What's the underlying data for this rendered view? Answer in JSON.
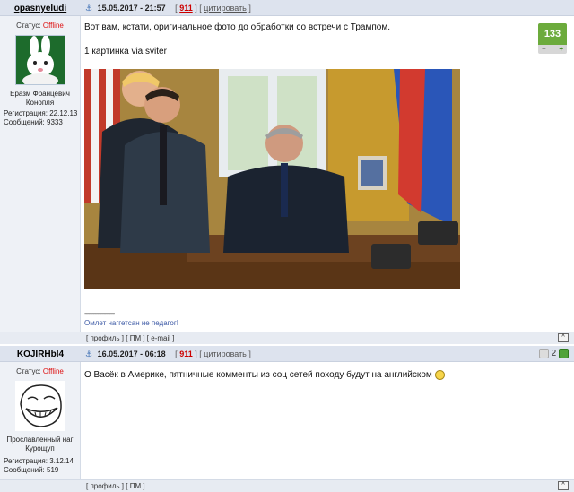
{
  "posts": [
    {
      "username": "opasnyeludi",
      "status_label": "Статус:",
      "status_value": "Offline",
      "rank": [
        "Еразм Францевич",
        "Конопля"
      ],
      "registration": "Регистрация: 22.12.13",
      "messages": "Сообщений: 9333",
      "date": "15.05.2017 - 21:57",
      "post_number": "911",
      "cite_label": "цитировать",
      "text_lines": [
        "Вот вам, кстати, оригинальное фото до обработки со встречи с Трампом.",
        "1 картинка via sviter"
      ],
      "signature_line": "--------------------",
      "signature": "Омлет наггетсан не педагог!",
      "footer_links": [
        "профиль",
        "ПМ",
        "e-mail"
      ],
      "rating": "133",
      "rating_minus": "−",
      "rating_plus": "+",
      "top_label": "^"
    },
    {
      "username": "KOJIRHbl4",
      "status_label": "Статус:",
      "status_value": "Offline",
      "rank": [
        "Прославленный наг",
        "Курощуп"
      ],
      "registration": "Регистрация: 3.12.14",
      "messages": "Сообщений: 519",
      "date": "16.05.2017 - 06:18",
      "post_number": "911",
      "cite_label": "цитировать",
      "text": "О Васёк в Америке, пятничные комменты из соц сетей походу будут на английском",
      "footer_links": [
        "профиль",
        "ПМ"
      ],
      "rating": "2",
      "top_label": "^"
    }
  ],
  "colors": {
    "offline": "#dd1111",
    "rating_green": "#6cab3c",
    "post_number": "#cc0000",
    "header_bg": "#dde3ee",
    "sidebar_bg": "#eef1f6"
  },
  "icons": {
    "anchor": "anchor-icon",
    "avatar1": "white-rabbit-avatar",
    "avatar2": "trollface-avatar",
    "emoji": "smile-emoji-icon"
  }
}
